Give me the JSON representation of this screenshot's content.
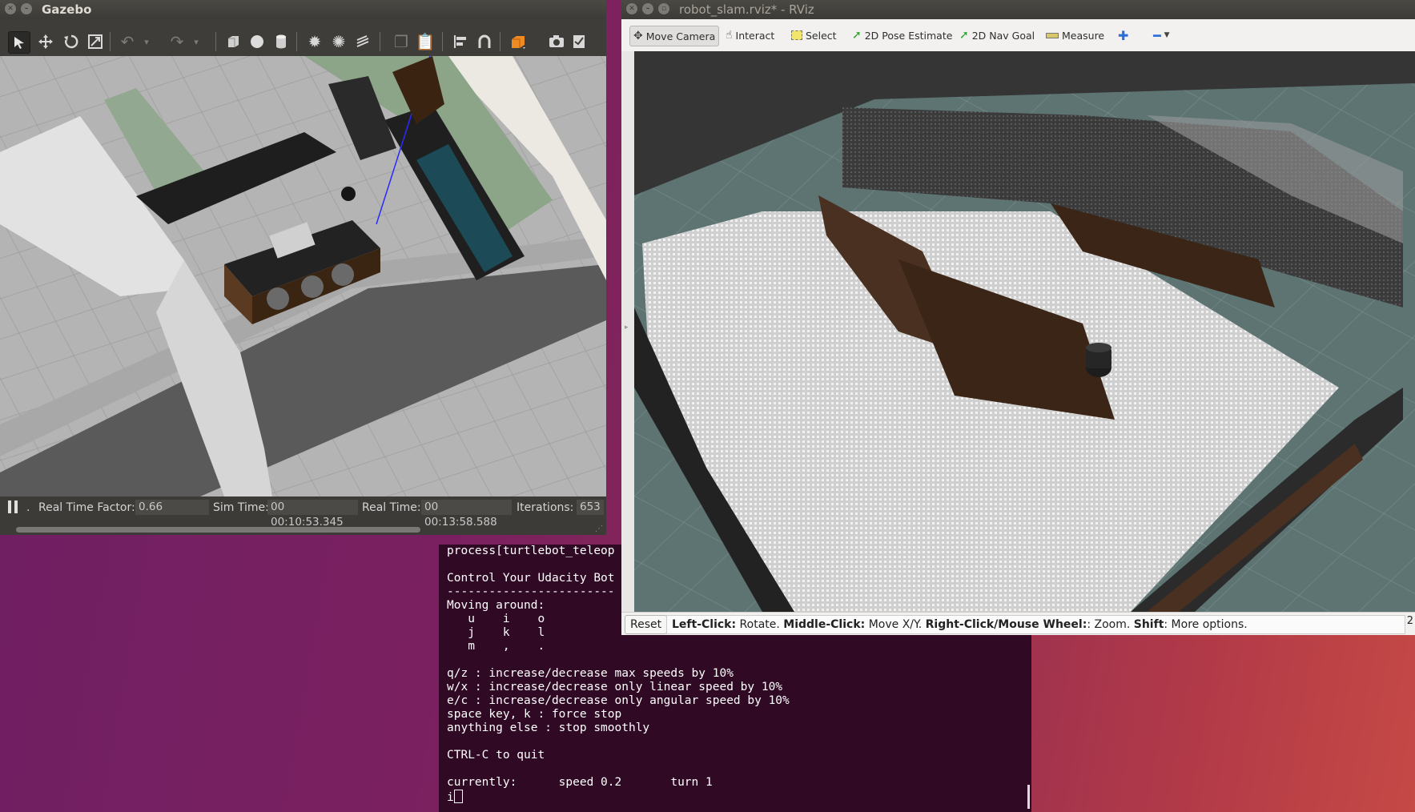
{
  "gazebo": {
    "title": "Gazebo",
    "status": {
      "rtf_label": "Real Time Factor:",
      "rtf_value": "0.66",
      "sim_label": "Sim Time:",
      "sim_value": "00 00:10:53.345",
      "real_label": "Real Time:",
      "real_value": "00 00:13:58.588",
      "iter_label": "Iterations:",
      "iter_value": "653"
    },
    "tool_icons": [
      "select-arrow-icon",
      "translate-icon",
      "rotate-icon",
      "scale-icon",
      "undo-icon",
      "redo-icon",
      "box-icon",
      "sphere-icon",
      "cylinder-icon",
      "point-light-icon",
      "spot-light-icon",
      "directional-light-icon",
      "copy-icon",
      "paste-icon",
      "align-icon",
      "snap-icon",
      "view-angle-icon",
      "screenshot-icon",
      "log-icon"
    ]
  },
  "rviz": {
    "title": "robot_slam.rviz* - RViz",
    "toolbar": {
      "move_camera": "Move Camera",
      "interact": "Interact",
      "select": "Select",
      "pose_estimate": "2D Pose Estimate",
      "nav_goal": "2D Nav Goal",
      "measure": "Measure"
    },
    "status": {
      "reset": "Reset",
      "left_click": "Left-Click:",
      "left_click_desc": " Rotate. ",
      "middle_click": "Middle-Click:",
      "middle_click_desc": " Move X/Y. ",
      "right_click": "Right-Click/Mouse Wheel:",
      "right_click_desc": ": Zoom. ",
      "shift": "Shift",
      "shift_desc": ": More options.",
      "fps": "2"
    }
  },
  "terminal": {
    "lines": [
      "process[turtlebot_teleop",
      "",
      "Control Your Udacity Bot",
      "------------------------",
      "Moving around:",
      "   u    i    o",
      "   j    k    l",
      "   m    ,    .",
      "",
      "q/z : increase/decrease max speeds by 10%",
      "w/x : increase/decrease only linear speed by 10%",
      "e/c : increase/decrease only angular speed by 10%",
      "space key, k : force stop",
      "anything else : stop smoothly",
      "",
      "CTRL-C to quit",
      "",
      "currently:      speed 0.2       turn 1",
      "i"
    ]
  }
}
